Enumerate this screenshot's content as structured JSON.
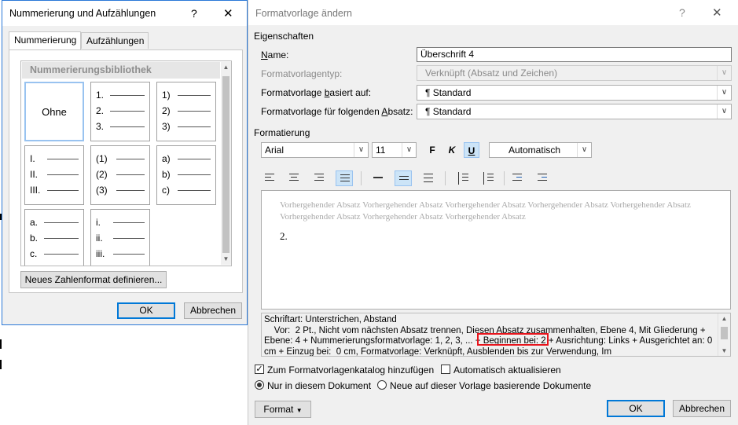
{
  "left_dialog": {
    "title": "Nummerierung und Aufzählungen",
    "help": "?",
    "close": "✕",
    "tabs": [
      "Nummerierung",
      "Aufzählungen"
    ],
    "library_header": "Nummerierungsbibliothek",
    "none_label": "Ohne",
    "formats": [
      [
        "1.",
        "2.",
        "3."
      ],
      [
        "1)",
        "2)",
        "3)"
      ],
      [
        "I.",
        "II.",
        "III."
      ],
      [
        "(1)",
        "(2)",
        "(3)"
      ],
      [
        "a)",
        "b)",
        "c)"
      ],
      [
        "a.",
        "b.",
        "c."
      ],
      [
        "i.",
        "ii.",
        "iii."
      ]
    ],
    "define_button": "Neues Zahlenformat definieren...",
    "ok": "OK",
    "cancel": "Abbrechen"
  },
  "right_dialog": {
    "title": "Formatvorlage ändern",
    "help": "?",
    "close": "✕",
    "properties_header": "Eigenschaften",
    "name_label": "Name:",
    "name_value": "Überschrift 4",
    "type_label": "Formatvorlagentyp:",
    "type_value": "Verknüpft (Absatz und Zeichen)",
    "based_label": "Formatvorlage basiert auf:",
    "based_value": "¶  Standard",
    "next_label": "Formatvorlage für folgenden Absatz:",
    "next_value": "¶  Standard",
    "formatting_header": "Formatierung",
    "font": "Arial",
    "size": "11",
    "bold": "F",
    "italic": "K",
    "underline": "U",
    "color": "Automatisch",
    "preview_text": "Vorhergehender Absatz Vorhergehender Absatz Vorhergehender Absatz Vorhergehender Absatz Vorhergehender Absatz Vorhergehender Absatz Vorhergehender Absatz Vorhergehender Absatz",
    "preview_number": "2.",
    "description": "Schriftart: Unterstrichen, Abstand\n    Vor:  2 Pt., Nicht vom nächsten Absatz trennen, Diesen Absatz zusammenhalten, Ebene 4, Mit Gliederung + Ebene: 4 + Nummerierungsformatvorlage: 1, 2, 3, ... + Beginnen bei: 2 + Ausrichtung: Links + Ausgerichtet an: 0 cm + Einzug bei:  0 cm, Formatvorlage: Verknüpft, Ausblenden bis zur Verwendung, Im",
    "add_to_gallery": "Zum Formatvorlagenkatalog hinzufügen",
    "auto_update": "Automatisch aktualisieren",
    "only_this_doc": "Nur in diesem Dokument",
    "new_docs": "Neue auf dieser Vorlage basierende Dokumente",
    "format_button": "Format",
    "ok": "OK",
    "cancel": "Abbrechen"
  }
}
